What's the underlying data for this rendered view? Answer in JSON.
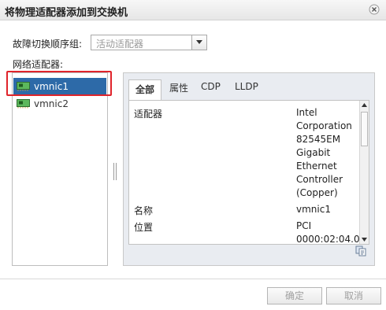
{
  "dialog": {
    "title": "将物理适配器添加到交换机"
  },
  "failover": {
    "label": "故障切换顺序组:",
    "selected": "活动适配器"
  },
  "adapters": {
    "label": "网络适配器:",
    "items": [
      {
        "name": "vmnic1",
        "selected": true
      },
      {
        "name": "vmnic2",
        "selected": false
      }
    ]
  },
  "tabs": [
    "全部",
    "属性",
    "CDP",
    "LLDP"
  ],
  "details": {
    "adapter_key": "适配器",
    "adapter_value": [
      "Intel",
      "Corporation",
      "82545EM",
      "Gigabit",
      "Ethernet",
      "Controller",
      "(Copper)"
    ],
    "name_key": "名称",
    "name_value": "vmnic1",
    "location_key": "位置",
    "location_value": [
      "PCI",
      "0000:02:04.0"
    ]
  },
  "buttons": {
    "ok": "确定",
    "cancel": "取消"
  },
  "colors": {
    "selection": "#2d6aa8",
    "highlight_box": "#e0242b"
  },
  "icons": [
    "close-icon",
    "chevron-down-icon",
    "network-card-icon",
    "copy-icon"
  ]
}
